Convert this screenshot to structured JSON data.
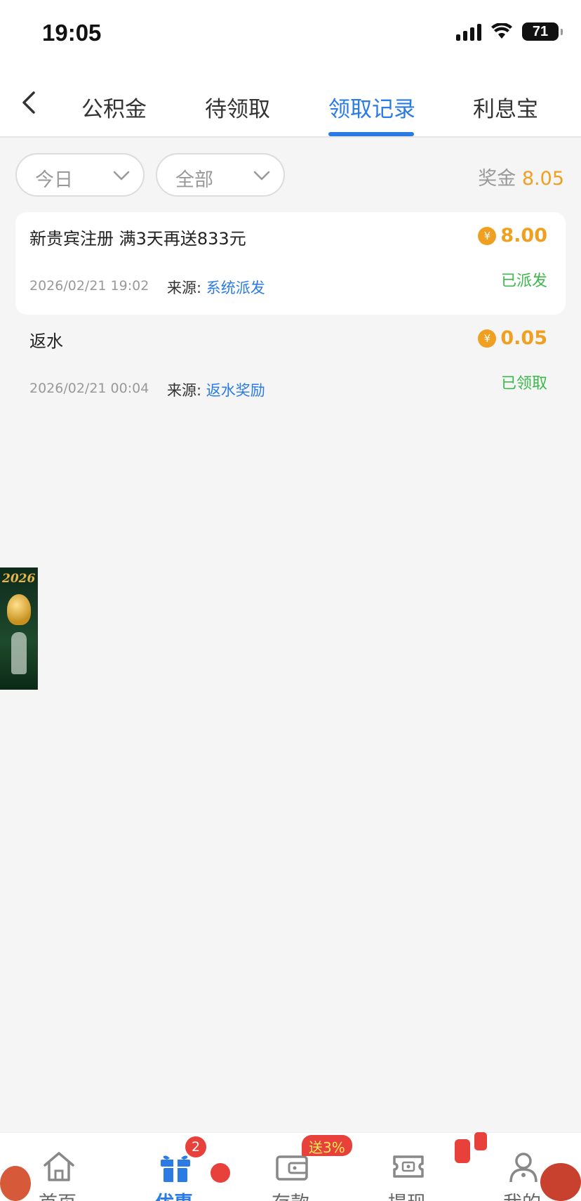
{
  "status_bar": {
    "time": "19:05",
    "battery": "71"
  },
  "tabs": [
    {
      "label": "公积金"
    },
    {
      "label": "待领取"
    },
    {
      "label": "领取记录"
    },
    {
      "label": "利息宝"
    }
  ],
  "active_tab": "领取记录",
  "filters": {
    "date": "今日",
    "type": "全部"
  },
  "bonus": {
    "label": "奖金",
    "value": "8.05"
  },
  "records": [
    {
      "title": "新贵宾注册 满3天再送833元",
      "amount": "8.00",
      "time": "2026/02/21 19:02",
      "source_label": "来源:",
      "source": "系统派发",
      "status": "已派发"
    },
    {
      "title": "返水",
      "amount": "0.05",
      "time": "2026/02/21 00:04",
      "source_label": "来源:",
      "source": "返水奖励",
      "status": "已领取"
    }
  ],
  "coin_symbol": "¥",
  "side_banner": {
    "text": "2026"
  },
  "bottom_nav": {
    "items": [
      {
        "label": "首页",
        "icon": "home-icon"
      },
      {
        "label": "优惠",
        "icon": "gift-icon"
      },
      {
        "label": "存款",
        "icon": "wallet-icon"
      },
      {
        "label": "提现",
        "icon": "withdraw-icon"
      },
      {
        "label": "我的",
        "icon": "user-icon"
      }
    ],
    "promo_badge": "送3%",
    "gift_badge_count": "2"
  },
  "colors": {
    "accent": "#2a7be4",
    "gold": "#f0a020",
    "green": "#3cb84c",
    "badge": "#e8403a"
  }
}
